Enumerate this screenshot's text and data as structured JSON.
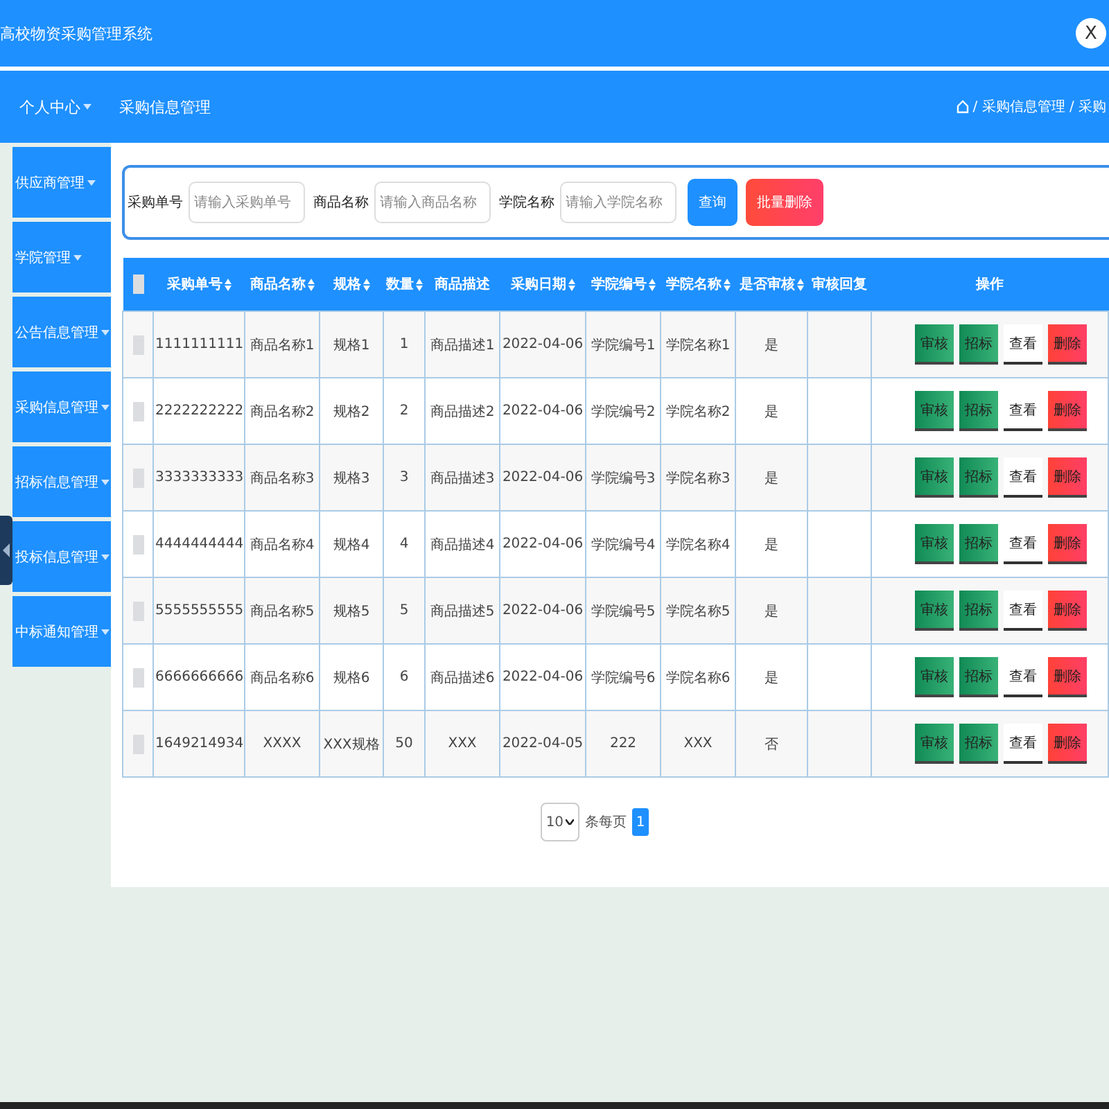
{
  "header": {
    "title": "高校物资采购管理系统",
    "logout_label": "X"
  },
  "nav": {
    "user_menu": "个人中心",
    "page_title": "采购信息管理",
    "breadcrumb": "/ 采购信息管理 / 采购"
  },
  "sidebar": {
    "items": [
      {
        "label": "供应商管理"
      },
      {
        "label": "学院管理"
      },
      {
        "label": "公告信息管理"
      },
      {
        "label": "采购信息管理"
      },
      {
        "label": "招标信息管理"
      },
      {
        "label": "投标信息管理"
      },
      {
        "label": "中标通知管理"
      }
    ]
  },
  "search": {
    "fields": [
      {
        "label": "采购单号",
        "placeholder": "请输入采购单号"
      },
      {
        "label": "商品名称",
        "placeholder": "请输入商品名称"
      },
      {
        "label": "学院名称",
        "placeholder": "请输入学院名称"
      }
    ],
    "buttons": [
      {
        "label": "查询",
        "kind": "primary"
      },
      {
        "label": "批量删除",
        "kind": "danger"
      }
    ]
  },
  "table": {
    "select_all_checked": false,
    "columns": [
      {
        "label": "采购单号",
        "sortable": true
      },
      {
        "label": "商品名称",
        "sortable": true
      },
      {
        "label": "规格",
        "sortable": true
      },
      {
        "label": "数量",
        "sortable": true
      },
      {
        "label": "商品描述",
        "sortable": false
      },
      {
        "label": "采购日期",
        "sortable": true
      },
      {
        "label": "学院编号",
        "sortable": true
      },
      {
        "label": "学院名称",
        "sortable": true
      },
      {
        "label": "是否审核",
        "sortable": true
      },
      {
        "label": "审核回复",
        "sortable": false
      },
      {
        "label": "操作",
        "sortable": false
      }
    ],
    "rows": [
      {
        "checked": false,
        "cells": [
          "1111111111",
          "商品名称1",
          "规格1",
          "1",
          "商品描述1",
          "2022-04-06",
          "学院编号1",
          "学院名称1",
          "是"
        ],
        "actions": [
          {
            "label": "审核",
            "kind": "success"
          },
          {
            "label": "招标",
            "kind": "success"
          },
          {
            "label": "查看",
            "kind": "plain"
          },
          {
            "label": "删除",
            "kind": "danger"
          }
        ]
      },
      {
        "checked": false,
        "cells": [
          "2222222222",
          "商品名称2",
          "规格2",
          "2",
          "商品描述2",
          "2022-04-06",
          "学院编号2",
          "学院名称2",
          "是"
        ],
        "actions": [
          {
            "label": "审核",
            "kind": "success"
          },
          {
            "label": "招标",
            "kind": "success"
          },
          {
            "label": "查看",
            "kind": "plain"
          },
          {
            "label": "删除",
            "kind": "danger"
          }
        ]
      },
      {
        "checked": false,
        "cells": [
          "3333333333",
          "商品名称3",
          "规格3",
          "3",
          "商品描述3",
          "2022-04-06",
          "学院编号3",
          "学院名称3",
          "是"
        ],
        "actions": [
          {
            "label": "审核",
            "kind": "success"
          },
          {
            "label": "招标",
            "kind": "success"
          },
          {
            "label": "查看",
            "kind": "plain"
          },
          {
            "label": "删除",
            "kind": "danger"
          }
        ]
      },
      {
        "checked": false,
        "cells": [
          "4444444444",
          "商品名称4",
          "规格4",
          "4",
          "商品描述4",
          "2022-04-06",
          "学院编号4",
          "学院名称4",
          "是"
        ],
        "actions": [
          {
            "label": "审核",
            "kind": "success"
          },
          {
            "label": "招标",
            "kind": "success"
          },
          {
            "label": "查看",
            "kind": "plain"
          },
          {
            "label": "删除",
            "kind": "danger"
          }
        ]
      },
      {
        "checked": false,
        "cells": [
          "5555555555",
          "商品名称5",
          "规格5",
          "5",
          "商品描述5",
          "2022-04-06",
          "学院编号5",
          "学院名称5",
          "是"
        ],
        "actions": [
          {
            "label": "审核",
            "kind": "success"
          },
          {
            "label": "招标",
            "kind": "success"
          },
          {
            "label": "查看",
            "kind": "plain"
          },
          {
            "label": "删除",
            "kind": "danger"
          }
        ]
      },
      {
        "checked": false,
        "cells": [
          "6666666666",
          "商品名称6",
          "规格6",
          "6",
          "商品描述6",
          "2022-04-06",
          "学院编号6",
          "学院名称6",
          "是"
        ],
        "actions": [
          {
            "label": "审核",
            "kind": "success"
          },
          {
            "label": "招标",
            "kind": "success"
          },
          {
            "label": "查看",
            "kind": "plain"
          },
          {
            "label": "删除",
            "kind": "danger"
          }
        ]
      },
      {
        "checked": false,
        "cells": [
          "1649214934",
          "XXXX",
          "XXX规格",
          "50",
          "XXX",
          "2022-04-05",
          "222",
          "XXX",
          "否"
        ],
        "actions": [
          {
            "label": "审核",
            "kind": "success"
          },
          {
            "label": "招标",
            "kind": "success"
          },
          {
            "label": "查看",
            "kind": "plain"
          },
          {
            "label": "删除",
            "kind": "danger"
          }
        ]
      }
    ]
  },
  "pagination": {
    "page_size": "10",
    "per_page_label": "条每页",
    "pages": [
      {
        "label": "1",
        "selected": true
      }
    ]
  }
}
